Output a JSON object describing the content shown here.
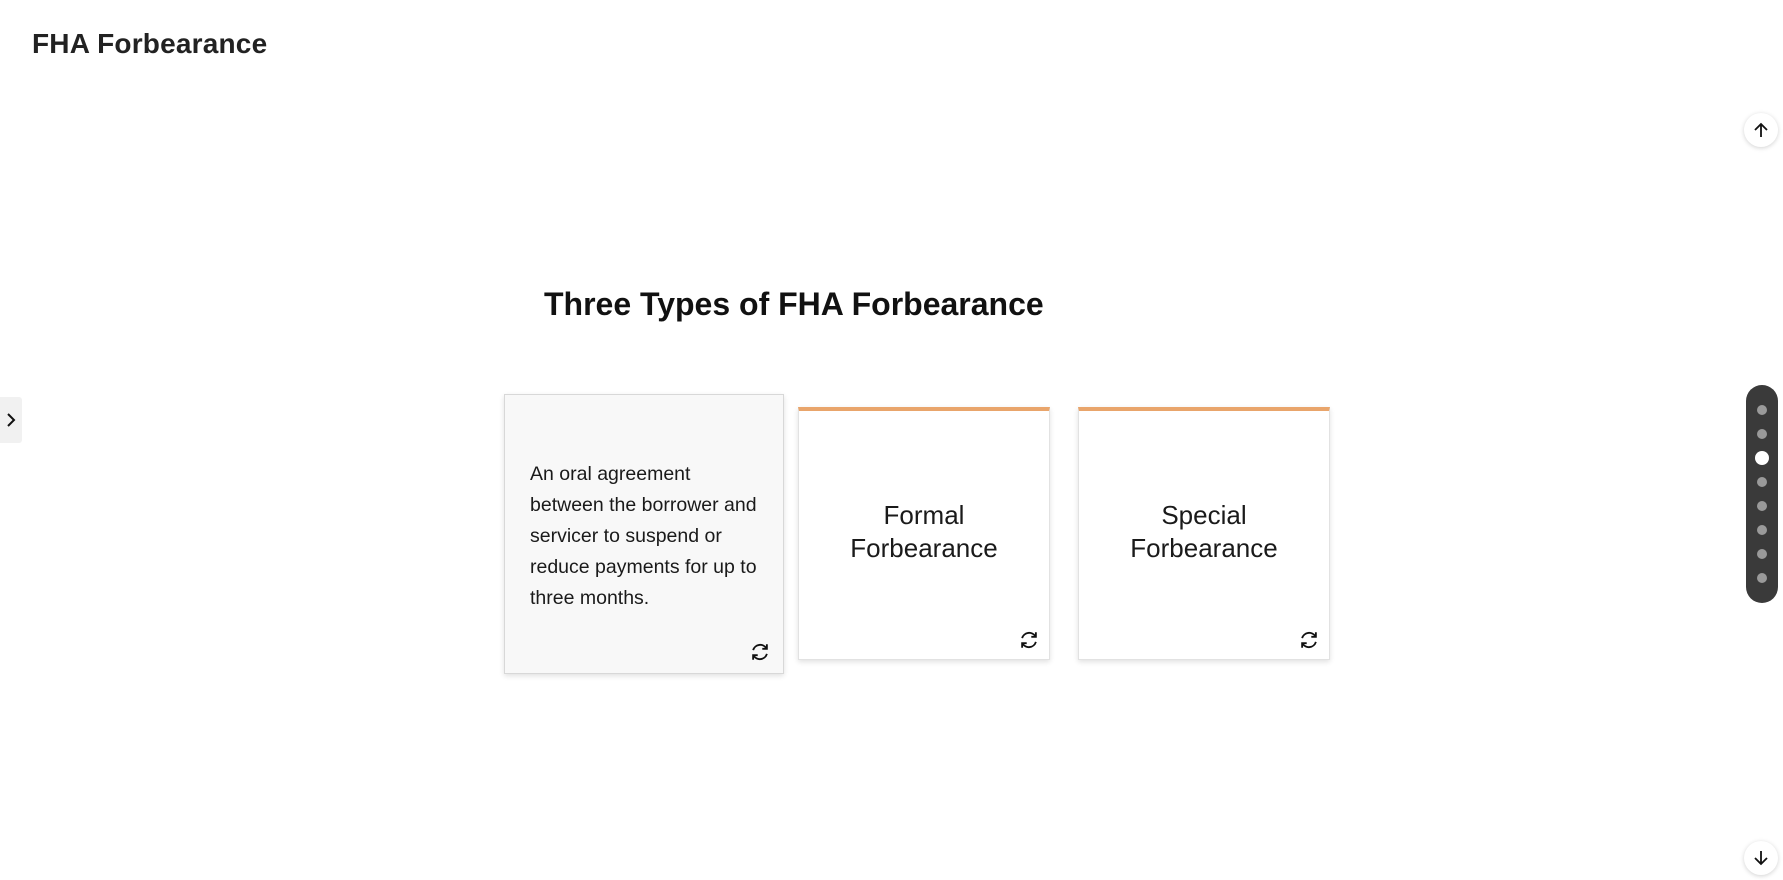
{
  "header": {
    "title": "FHA Forbearance"
  },
  "section": {
    "title": "Three Types of FHA Forbearance"
  },
  "cards": [
    {
      "side": "back",
      "text": "An oral agreement between the borrower and servicer to suspend or reduce payments for up to three months.",
      "icon": "flip-icon"
    },
    {
      "side": "front",
      "line1": "Formal",
      "line2": "Forbearance",
      "accent_color": "#e9a56b",
      "icon": "flip-icon"
    },
    {
      "side": "front",
      "line1": "Special",
      "line2": "Forbearance",
      "accent_color": "#e9a56b",
      "icon": "flip-icon"
    }
  ],
  "navigation": {
    "sidebar_toggle_icon": "chevron-right-icon",
    "scroll_up_icon": "arrow-up-icon",
    "scroll_down_icon": "arrow-down-icon",
    "dot_count": 8,
    "active_dot": 3
  },
  "colors": {
    "accent": "#e9a56b",
    "dot_nav_bg": "#3a3a3a",
    "dot_inactive": "#9a9a9a",
    "dot_active": "#ffffff"
  }
}
